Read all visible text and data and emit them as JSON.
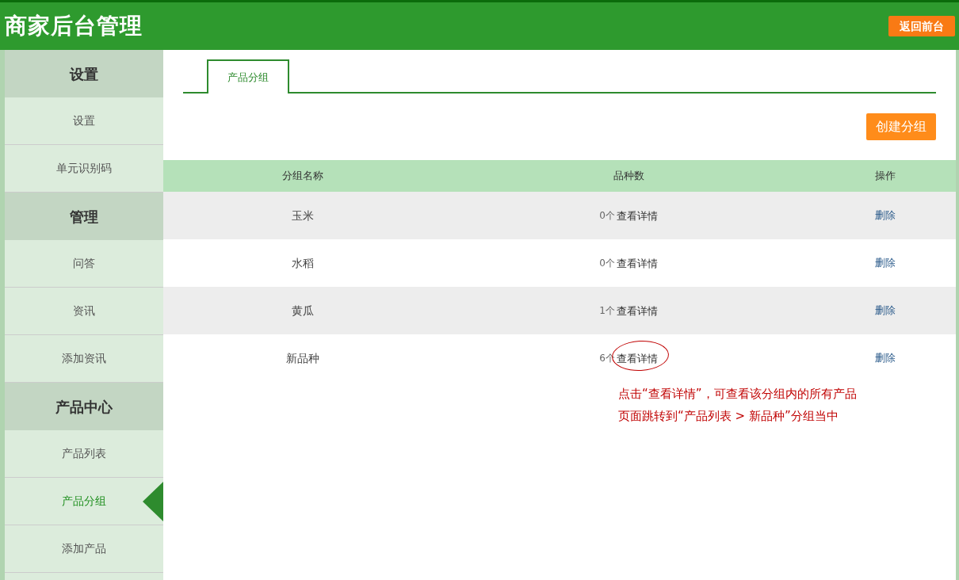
{
  "header": {
    "title": "商家后台管理",
    "back_button": "返回前台"
  },
  "sidebar": {
    "sections": [
      {
        "title": "设置",
        "items": [
          {
            "label": "设置",
            "selected": false
          },
          {
            "label": "单元识别码",
            "selected": false
          }
        ]
      },
      {
        "title": "管理",
        "items": [
          {
            "label": "问答",
            "selected": false
          },
          {
            "label": "资讯",
            "selected": false
          },
          {
            "label": "添加资讯",
            "selected": false
          }
        ]
      },
      {
        "title": "产品中心",
        "items": [
          {
            "label": "产品列表",
            "selected": false
          },
          {
            "label": "产品分组",
            "selected": true
          },
          {
            "label": "添加产品",
            "selected": false
          }
        ]
      }
    ]
  },
  "tabs": [
    {
      "label": "产品分组",
      "selected": true
    }
  ],
  "create_button": "创建分组",
  "table": {
    "columns": [
      "分组名称",
      "品种数",
      "操作"
    ],
    "rows": [
      {
        "name": "玉米",
        "count": "0个",
        "details_link": "查看详情",
        "action": "删除",
        "circled": false
      },
      {
        "name": "水稻",
        "count": "0个",
        "details_link": "查看详情",
        "action": "删除",
        "circled": false
      },
      {
        "name": "黄瓜",
        "count": "1个",
        "details_link": "查看详情",
        "action": "删除",
        "circled": false
      },
      {
        "name": "新品种",
        "count": "6个",
        "details_link": "查看详情",
        "action": "删除",
        "circled": true
      }
    ]
  },
  "annotation": {
    "lines": [
      "点击“查看详情”，可查看该分组内的所有产品",
      "页面跳转到“产品列表 > 新品种”分组当中"
    ]
  }
}
